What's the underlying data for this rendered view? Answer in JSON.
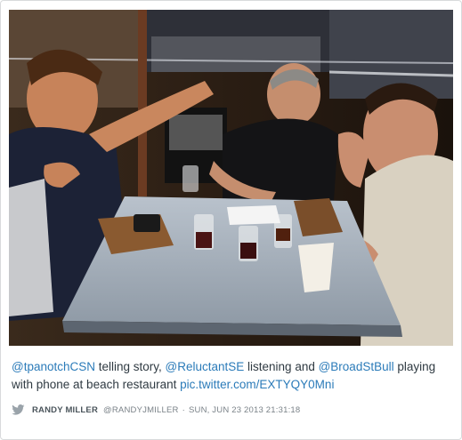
{
  "photo": {
    "alt": ""
  },
  "caption": {
    "mention_1": "@tpanotchCSN",
    "text_1": " telling story, ",
    "mention_2": "@ReluctantSE",
    "text_2": " listening and ",
    "mention_3": "@BroadStBull",
    "text_3": " playing with phone at beach restaurant ",
    "link": "pic.twitter.com/EXTYQY0Mni"
  },
  "meta": {
    "bird_icon": "twitter-bird-icon",
    "author_name": "RANDY MILLER",
    "author_handle": "@RANDYJMILLER",
    "separator": "·",
    "timestamp": "SUN, JUN 23 2013 21:31:18"
  },
  "colors": {
    "link": "#2b7bb9",
    "text": "#2f3a42",
    "meta": "#7a8288"
  }
}
